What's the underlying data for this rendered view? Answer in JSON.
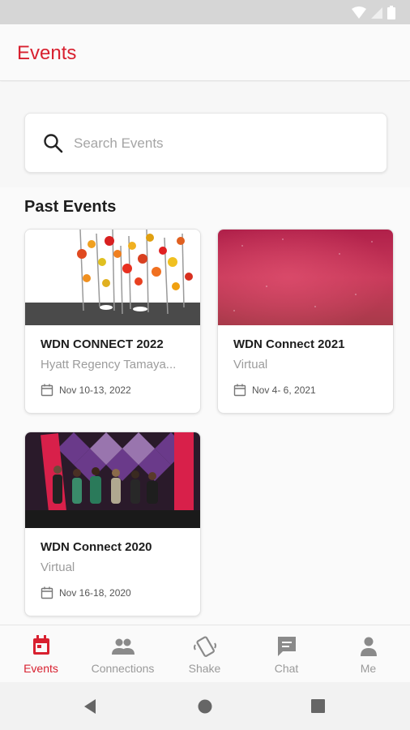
{
  "app": {
    "title": "Events"
  },
  "search": {
    "placeholder": "Search Events"
  },
  "sections": {
    "past_title": "Past Events"
  },
  "events": [
    {
      "title": "WDN CONNECT 2022",
      "location": "Hyatt Regency Tamaya...",
      "date": "Nov 10-13, 2022"
    },
    {
      "title": "WDN Connect 2021",
      "location": "Virtual",
      "date": "Nov  4- 6, 2021"
    },
    {
      "title": "WDN Connect 2020",
      "location": "Virtual",
      "date": "Nov 16-18, 2020"
    }
  ],
  "nav": {
    "items": [
      {
        "label": "Events",
        "icon": "calendar-icon",
        "active": true
      },
      {
        "label": "Connections",
        "icon": "people-icon",
        "active": false
      },
      {
        "label": "Shake",
        "icon": "shake-phone-icon",
        "active": false
      },
      {
        "label": "Chat",
        "icon": "chat-bubble-icon",
        "active": false
      },
      {
        "label": "Me",
        "icon": "person-icon",
        "active": false
      }
    ]
  },
  "colors": {
    "accent": "#d8202f",
    "inactive": "#9a9a9a",
    "background": "#fafafa"
  }
}
